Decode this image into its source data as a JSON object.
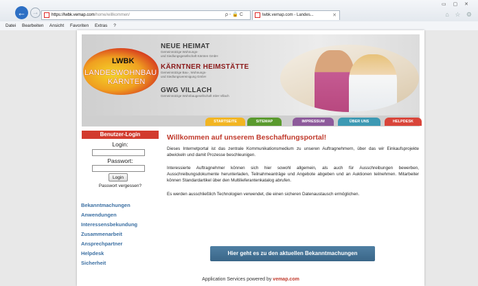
{
  "browser": {
    "url_host": "https://lwbk.vemap.com",
    "url_path": "/home/willkommen/",
    "address_tools": "ρ - 🔒 C",
    "tab_title": "lwbk.vemap.com - Landes...",
    "menu": [
      "Datei",
      "Bearbeiten",
      "Ansicht",
      "Favoriten",
      "Extras",
      "?"
    ]
  },
  "header": {
    "logo_abbr": "LWBK",
    "logo_line1": "LANDESWOHNBAU",
    "logo_line2": "KÄRNTEN",
    "orgs": [
      {
        "title": "NEUE HEIMAT",
        "sub1": "Gemeinnützige Wohnungs-",
        "sub2": "und Siedlungsgesellschaft Kärnten GmbH"
      },
      {
        "title": "KÄRNTNER HEIMSTÄTTE",
        "sub1": "Gemeinnützige Bau-, Wohnungs-",
        "sub2": "und Siedlungsvereinigung GmbH"
      },
      {
        "title": "GWG VILLACH",
        "sub1": "Gemeinnützige Wohnbaugesellschaft mbH Villach",
        "sub2": ""
      }
    ]
  },
  "nav": {
    "items": [
      {
        "label": "STARTSEITE",
        "color": "#f2b522"
      },
      {
        "label": "SITEMAP",
        "color": "#5a9a2e"
      },
      {
        "label": "IMPRESSUM",
        "color": "#8d5a9b"
      },
      {
        "label": "ÜBER UNS",
        "color": "#3d99b3"
      },
      {
        "label": "HELPDESK",
        "color": "#d9453a"
      }
    ]
  },
  "login": {
    "heading": "Benutzer-Login",
    "login_label": "Login:",
    "password_label": "Passwort:",
    "button": "Login",
    "forgot": "Passwort vergessen?"
  },
  "sidebar": {
    "links": [
      "Bekanntmachungen",
      "Anwendungen",
      "Interessensbekundung",
      "Zusammenarbeit",
      "Ansprechpartner",
      "Helpdesk",
      "Sicherheit"
    ]
  },
  "main": {
    "title": "Willkommen auf unserem Beschaffungsportal!",
    "p1": "Dieses Internetportal ist das zentrale Kommunikationsmedium zu unseren Auftragnehmern, über das wir Einkaufsprojekte abwickeln und damit Prozesse beschleunigen.",
    "p2": "Interessierte Auftragnehmer können sich hier sowohl allgemein, als auch für Ausschreibungen bewerben, Ausschreibungsdokumente herunterladen, Teilnahmeanträge und Angebote abgeben und an Auktionen teilnehmen. Mitarbeiter können Standardartikel über den Multilieferantenkatalog abrufen.",
    "p3": "Es werden ausschließlich Technologien verwendet, die einen sicheren Datenaustausch ermöglichen.",
    "cta": "Hier geht es zu den aktuellen Bekanntmachungen"
  },
  "footer": {
    "text": "Application Services powered by",
    "brand": "vemap.com"
  }
}
